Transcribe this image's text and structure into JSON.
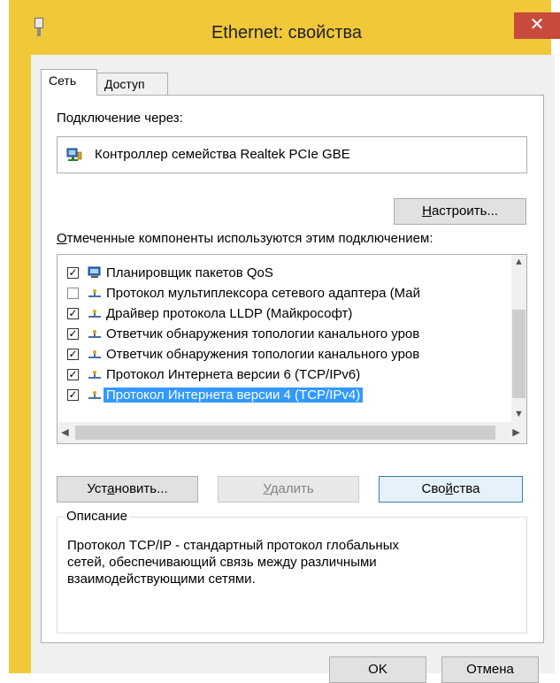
{
  "window": {
    "title": "Ethernet: свойства",
    "close_symbol": "✕",
    "accent_color": "#f0c83a",
    "close_color": "#c74b3c"
  },
  "tabs": [
    {
      "label": "Сеть",
      "active": true
    },
    {
      "label": "Доступ",
      "active": false
    }
  ],
  "connection": {
    "label": "Подключение через:",
    "adapter_name": "Контроллер семейства Realtek PCIe GBE",
    "adapter_icon": "network-adapter-icon"
  },
  "configure_button": {
    "label_pre": "",
    "label_accel": "Н",
    "label_post": "астроить..."
  },
  "components": {
    "label_accel": "О",
    "label_post": "тмеченные компоненты используются этим подключением:",
    "items": [
      {
        "checked": true,
        "icon": "qos-scheduler-icon",
        "label": "Планировщик пакетов QoS",
        "selected": false
      },
      {
        "checked": false,
        "icon": "protocol-icon",
        "label": "Протокол мультиплексора сетевого адаптера (Май",
        "selected": false
      },
      {
        "checked": true,
        "icon": "protocol-icon",
        "label": "Драйвер протокола LLDP (Майкрософт)",
        "selected": false
      },
      {
        "checked": true,
        "icon": "protocol-icon",
        "label": "Ответчик обнаружения топологии канального уров",
        "selected": false
      },
      {
        "checked": true,
        "icon": "protocol-icon",
        "label": "Ответчик обнаружения топологии канального уров",
        "selected": false
      },
      {
        "checked": true,
        "icon": "protocol-icon",
        "label": "Протокол Интернета версии 6 (TCP/IPv6)",
        "selected": false
      },
      {
        "checked": true,
        "icon": "protocol-icon",
        "label": "Протокол Интернета версии 4 (TCP/IPv4)",
        "selected": true
      }
    ]
  },
  "buttons": {
    "install": {
      "pre": "Уст",
      "accel": "а",
      "post": "новить..."
    },
    "remove": {
      "pre": "",
      "accel": "У",
      "post": "далить"
    },
    "properties": {
      "pre": "Сво",
      "accel": "й",
      "post": "ства"
    }
  },
  "description": {
    "title": "Описание",
    "text": "Протокол TCP/IP - стандартный протокол глобальных\nсетей, обеспечивающий связь между различными\nвзаимодействующими сетями."
  },
  "footer": {
    "ok": "OK",
    "cancel": "Отмена"
  }
}
